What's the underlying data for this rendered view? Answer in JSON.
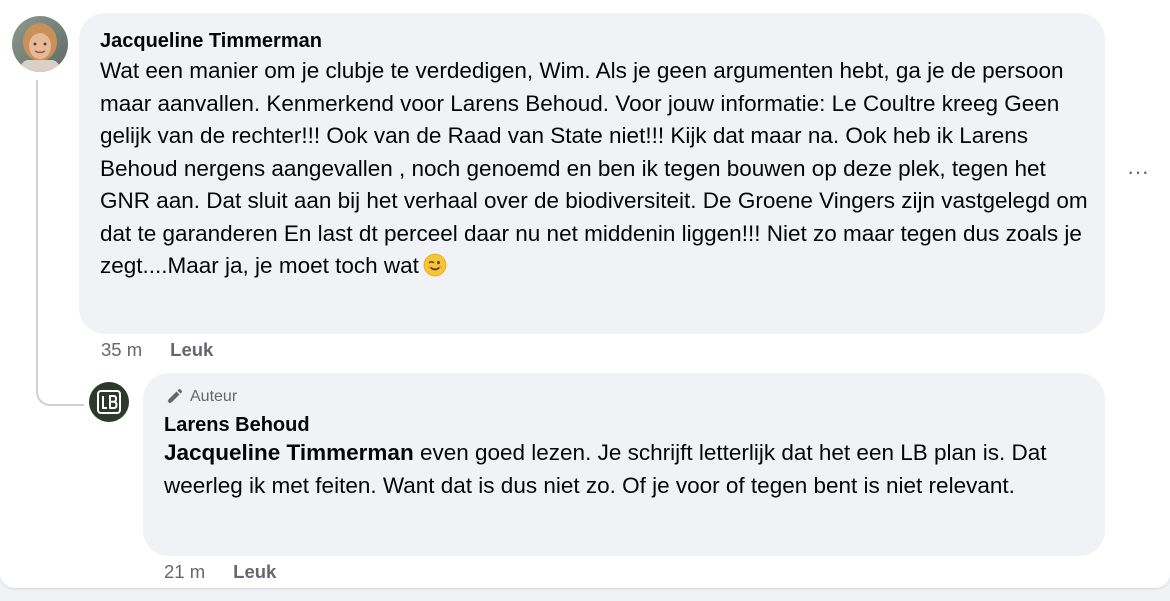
{
  "comments": [
    {
      "author": "Jacqueline Timmerman",
      "text": "Wat een manier om je clubje te verdedigen, Wim. Als je geen argumenten hebt, ga je de persoon maar aanvallen. Kenmerkend voor Larens Behoud. Voor jouw informatie: Le Coultre kreeg Geen gelijk van de rechter!!! Ook van de Raad van State niet!!! Kijk dat maar na. Ook heb ik Larens Behoud nergens aangevallen , noch genoemd en ben ik tegen bouwen op deze plek, tegen het GNR aan. Dat sluit aan bij het verhaal over de biodiversiteit. De Groene Vingers zijn vastgelegd om dat te garanderen En last dt perceel daar nu net middenin liggen!!! Niet zo maar tegen dus zoals je zegt....Maar ja, je moet toch wat",
      "emoji": "winking-face-emoji",
      "time": "35 m",
      "like_label": "Leuk"
    },
    {
      "badge": "Auteur",
      "author": "Larens Behoud",
      "mention": "Jacqueline Timmerman",
      "text": " even goed lezen. Je schrijft letterlijk dat het een LB plan is. Dat weerleg ik met feiten. Want dat is dus niet zo. Of je voor of tegen bent is niet relevant.",
      "time": "21 m",
      "like_label": "Leuk"
    }
  ],
  "more_label": "···",
  "icons": {
    "more": "more-options-icon",
    "author_badge": "pen-icon",
    "page_logo": "lb-logo-icon"
  },
  "colors": {
    "bubble_bg": "#f0f2f5",
    "text": "#050505",
    "secondary": "#65676b",
    "thread_line": "#ced0d4",
    "logo_bg": "#2b3a2a"
  }
}
